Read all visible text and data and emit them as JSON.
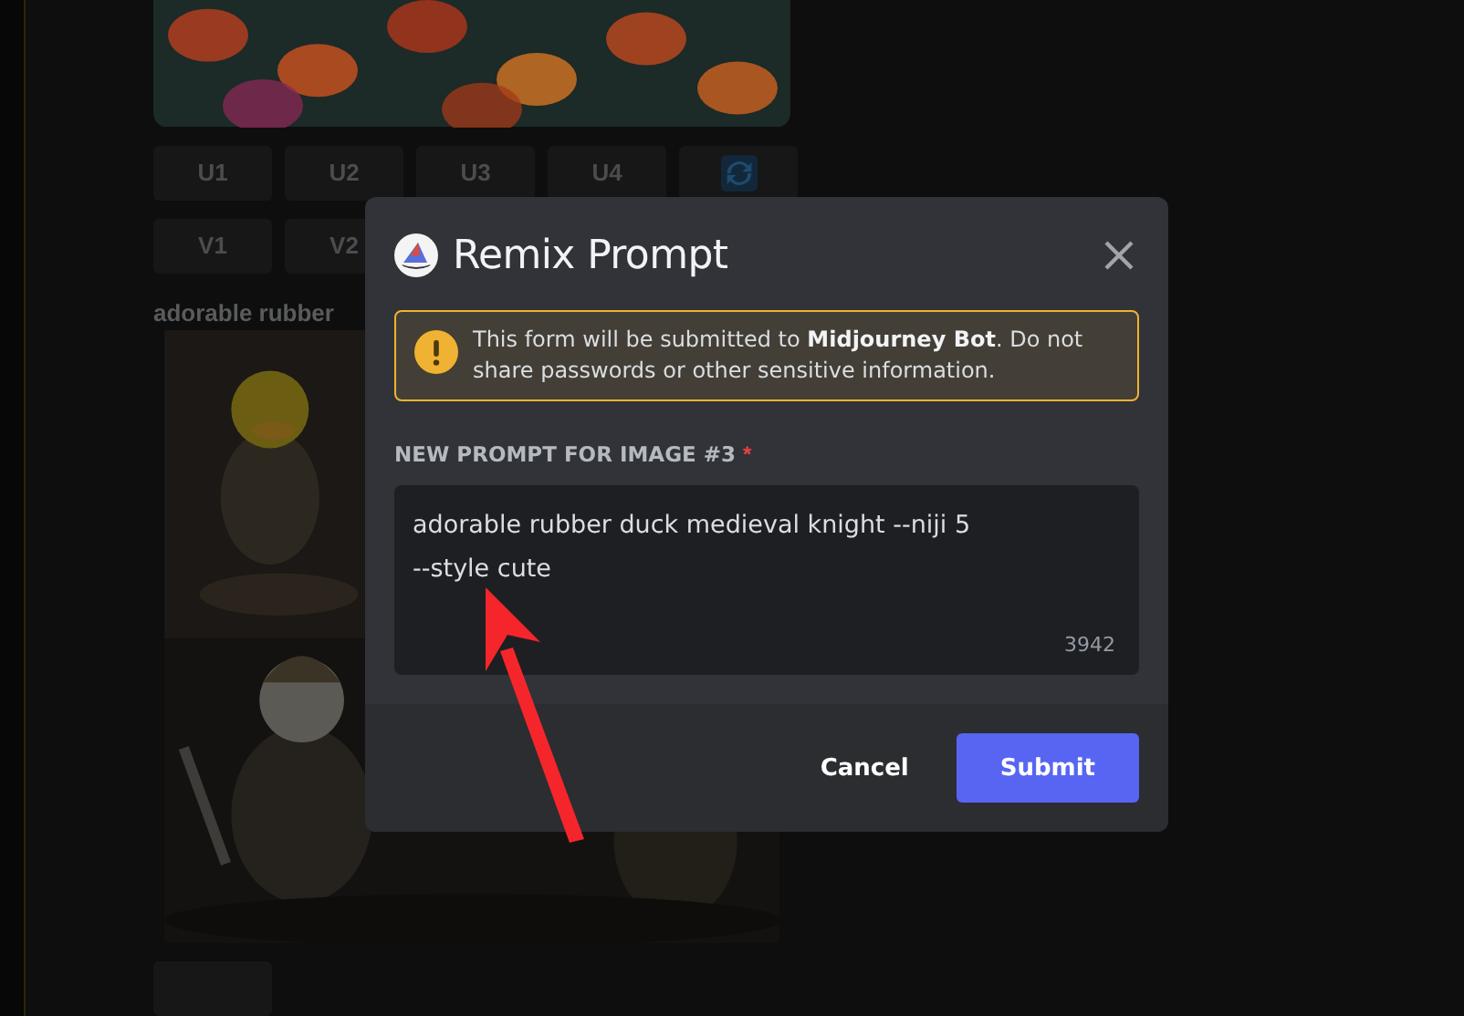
{
  "background": {
    "upscale_buttons": [
      {
        "label": "U1"
      },
      {
        "label": "U2"
      },
      {
        "label": "U3"
      },
      {
        "label": "U4"
      }
    ],
    "variation_buttons": [
      {
        "label": "V1"
      },
      {
        "label": "V2"
      }
    ],
    "message_title": "adorable rubber"
  },
  "modal": {
    "title": "Remix Prompt",
    "notice": "This form will be submitted to **Midjourney Bot**. Do not share passwords or other sensitive information.",
    "field": {
      "label": "NEW PROMPT FOR IMAGE #3",
      "required_mark": "*",
      "value": "adorable rubber duck medieval knight --niji 5\n--style cute",
      "counter": "3942"
    },
    "buttons": [
      {
        "label": "Cancel",
        "kind": "link"
      },
      {
        "label": "Submit",
        "kind": "primary"
      }
    ]
  }
}
